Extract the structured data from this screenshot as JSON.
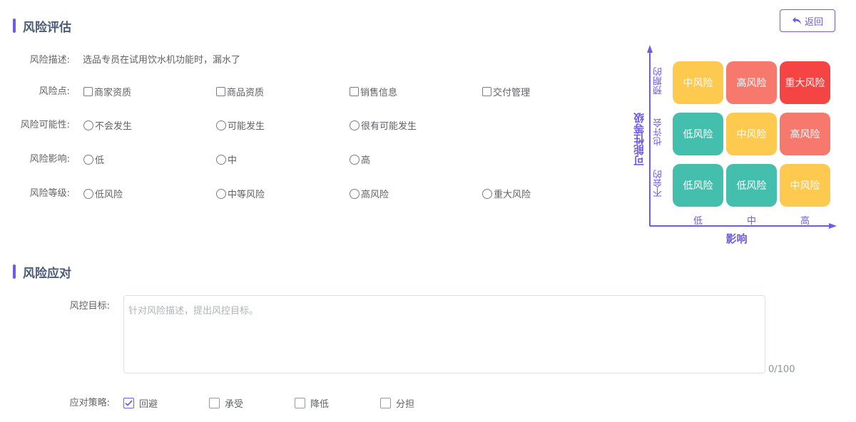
{
  "colors": {
    "accent": "#6f5be8",
    "low": "#44bfad",
    "medium": "#fdc94e",
    "high": "#f7796e",
    "major": "#f44444"
  },
  "back_button": {
    "icon": "return-arrow-icon",
    "label": "返回"
  },
  "assessment": {
    "title": "风险评估",
    "description": {
      "label": "风险描述:",
      "value": "选品专员在试用饮水机功能时，漏水了"
    },
    "risk_points": {
      "label": "风险点:",
      "options": [
        "商家资质",
        "商品资质",
        "销售信息",
        "交付管理"
      ]
    },
    "likelihood": {
      "label": "风险可能性:",
      "options": [
        "不会发生",
        "可能发生",
        "很有可能发生"
      ]
    },
    "impact": {
      "label": "风险影响:",
      "options": [
        "低",
        "中",
        "高"
      ]
    },
    "level": {
      "label": "风险等级:",
      "options": [
        "低风险",
        "中等风险",
        "高风险",
        "重大风险"
      ]
    }
  },
  "matrix": {
    "y_axis_title": "可能性等级",
    "x_axis_title": "影响",
    "rows": [
      "预期的",
      "也许会",
      "不会的"
    ],
    "cols": [
      "低",
      "中",
      "高"
    ],
    "cells": [
      [
        "中风险",
        "高风险",
        "重大风险"
      ],
      [
        "低风险",
        "中风险",
        "高风险"
      ],
      [
        "低风险",
        "低风险",
        "中风险"
      ]
    ]
  },
  "response": {
    "title": "风险应对",
    "goal": {
      "label": "风控目标:",
      "placeholder": "针对风险描述，提出风控目标。",
      "value": "",
      "counter": "0/100"
    },
    "strategy": {
      "label": "应对策略:",
      "options": [
        {
          "label": "回避",
          "checked": true
        },
        {
          "label": "承受",
          "checked": false
        },
        {
          "label": "降低",
          "checked": false
        },
        {
          "label": "分担",
          "checked": false
        }
      ]
    }
  }
}
